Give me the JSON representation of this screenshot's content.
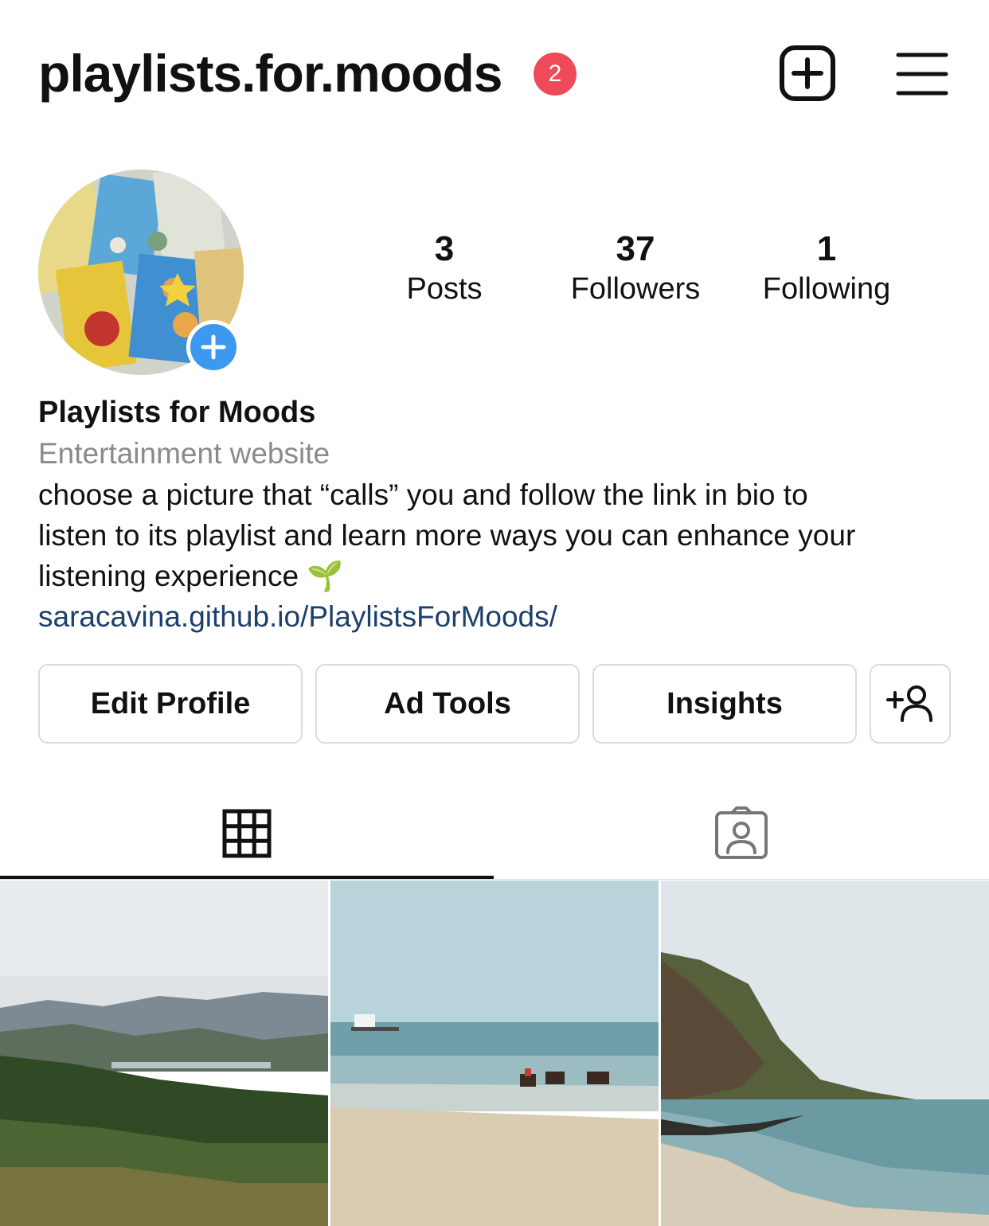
{
  "header": {
    "username": "playlists.for.moods",
    "notification_count": "2",
    "new_post_icon": "plus-square-icon",
    "menu_icon": "hamburger-menu-icon"
  },
  "stats": {
    "posts": {
      "count": "3",
      "label": "Posts"
    },
    "followers": {
      "count": "37",
      "label": "Followers"
    },
    "following": {
      "count": "1",
      "label": "Following"
    }
  },
  "bio": {
    "display_name": "Playlists for Moods",
    "category": "Entertainment website",
    "lines": [
      "choose a picture that “calls” you and follow the link in bio to",
      "listen to its playlist and learn more ways you can enhance your",
      "listening experience 🌱"
    ],
    "link": "saracavina.github.io/PlaylistsForMoods/"
  },
  "actions": {
    "edit_profile": "Edit Profile",
    "ad_tools": "Ad Tools",
    "insights": "Insights",
    "discover_people_icon": "add-person-icon"
  },
  "tabs": [
    {
      "icon": "grid-icon",
      "active": true
    },
    {
      "icon": "tagged-person-icon",
      "active": false
    }
  ],
  "colors": {
    "badge": "#ee4a5a",
    "avatar_add": "#3d98f0",
    "link": "#1c3f6b",
    "secondary_text": "#8a8a8a",
    "border": "#dbdbdb"
  },
  "posts": [
    {
      "subject": "green hills and lake landscape"
    },
    {
      "subject": "beach with horse-drawn cart"
    },
    {
      "subject": "rocky coastline with sea"
    }
  ]
}
